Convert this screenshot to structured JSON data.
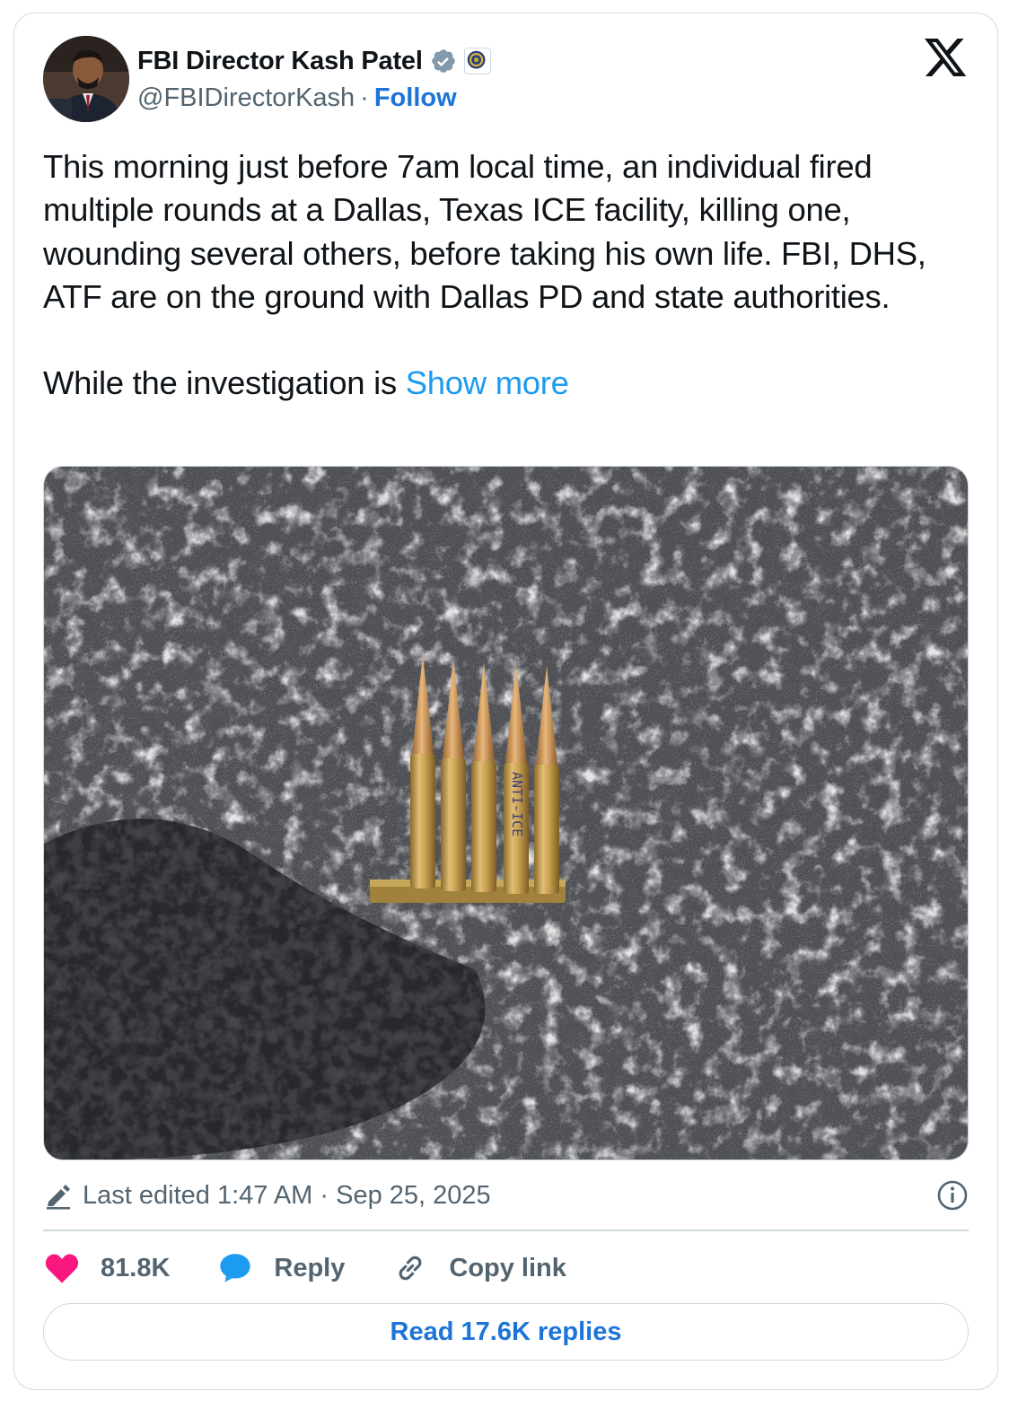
{
  "author": {
    "display_name": "FBI Director Kash Patel",
    "handle": "@FBIDirectorKash",
    "separator": "·",
    "follow_label": "Follow"
  },
  "tweet": {
    "paragraph1": "This morning just before 7am local time, an individual fired multiple rounds at a Dallas, Texas ICE facility, killing one, wounding several others, before taking his own life. FBI, DHS, ATF are on the ground with Dallas PD and state authorities.",
    "paragraph2_start": "While the investigation is ",
    "show_more": "Show more",
    "media_inscription": "ANTI-ICE"
  },
  "meta": {
    "edited_text": "Last edited 1:47 AM · Sep 25, 2025"
  },
  "actions": {
    "likes": "81.8K",
    "reply_label": "Reply",
    "copy_link_label": "Copy link"
  },
  "read_replies_label": "Read 17.6K replies",
  "colors": {
    "like": "#f91880",
    "reply": "#1d9bf0",
    "link": "#1d9bf0",
    "follow": "#1d74d8",
    "secondary": "#536471",
    "border": "#cfd9de"
  },
  "icons": [
    "verified-badge-icon",
    "fbi-seal-icon",
    "x-logo-icon",
    "pencil-icon",
    "info-icon",
    "heart-icon",
    "reply-bubble-icon",
    "link-icon"
  ]
}
